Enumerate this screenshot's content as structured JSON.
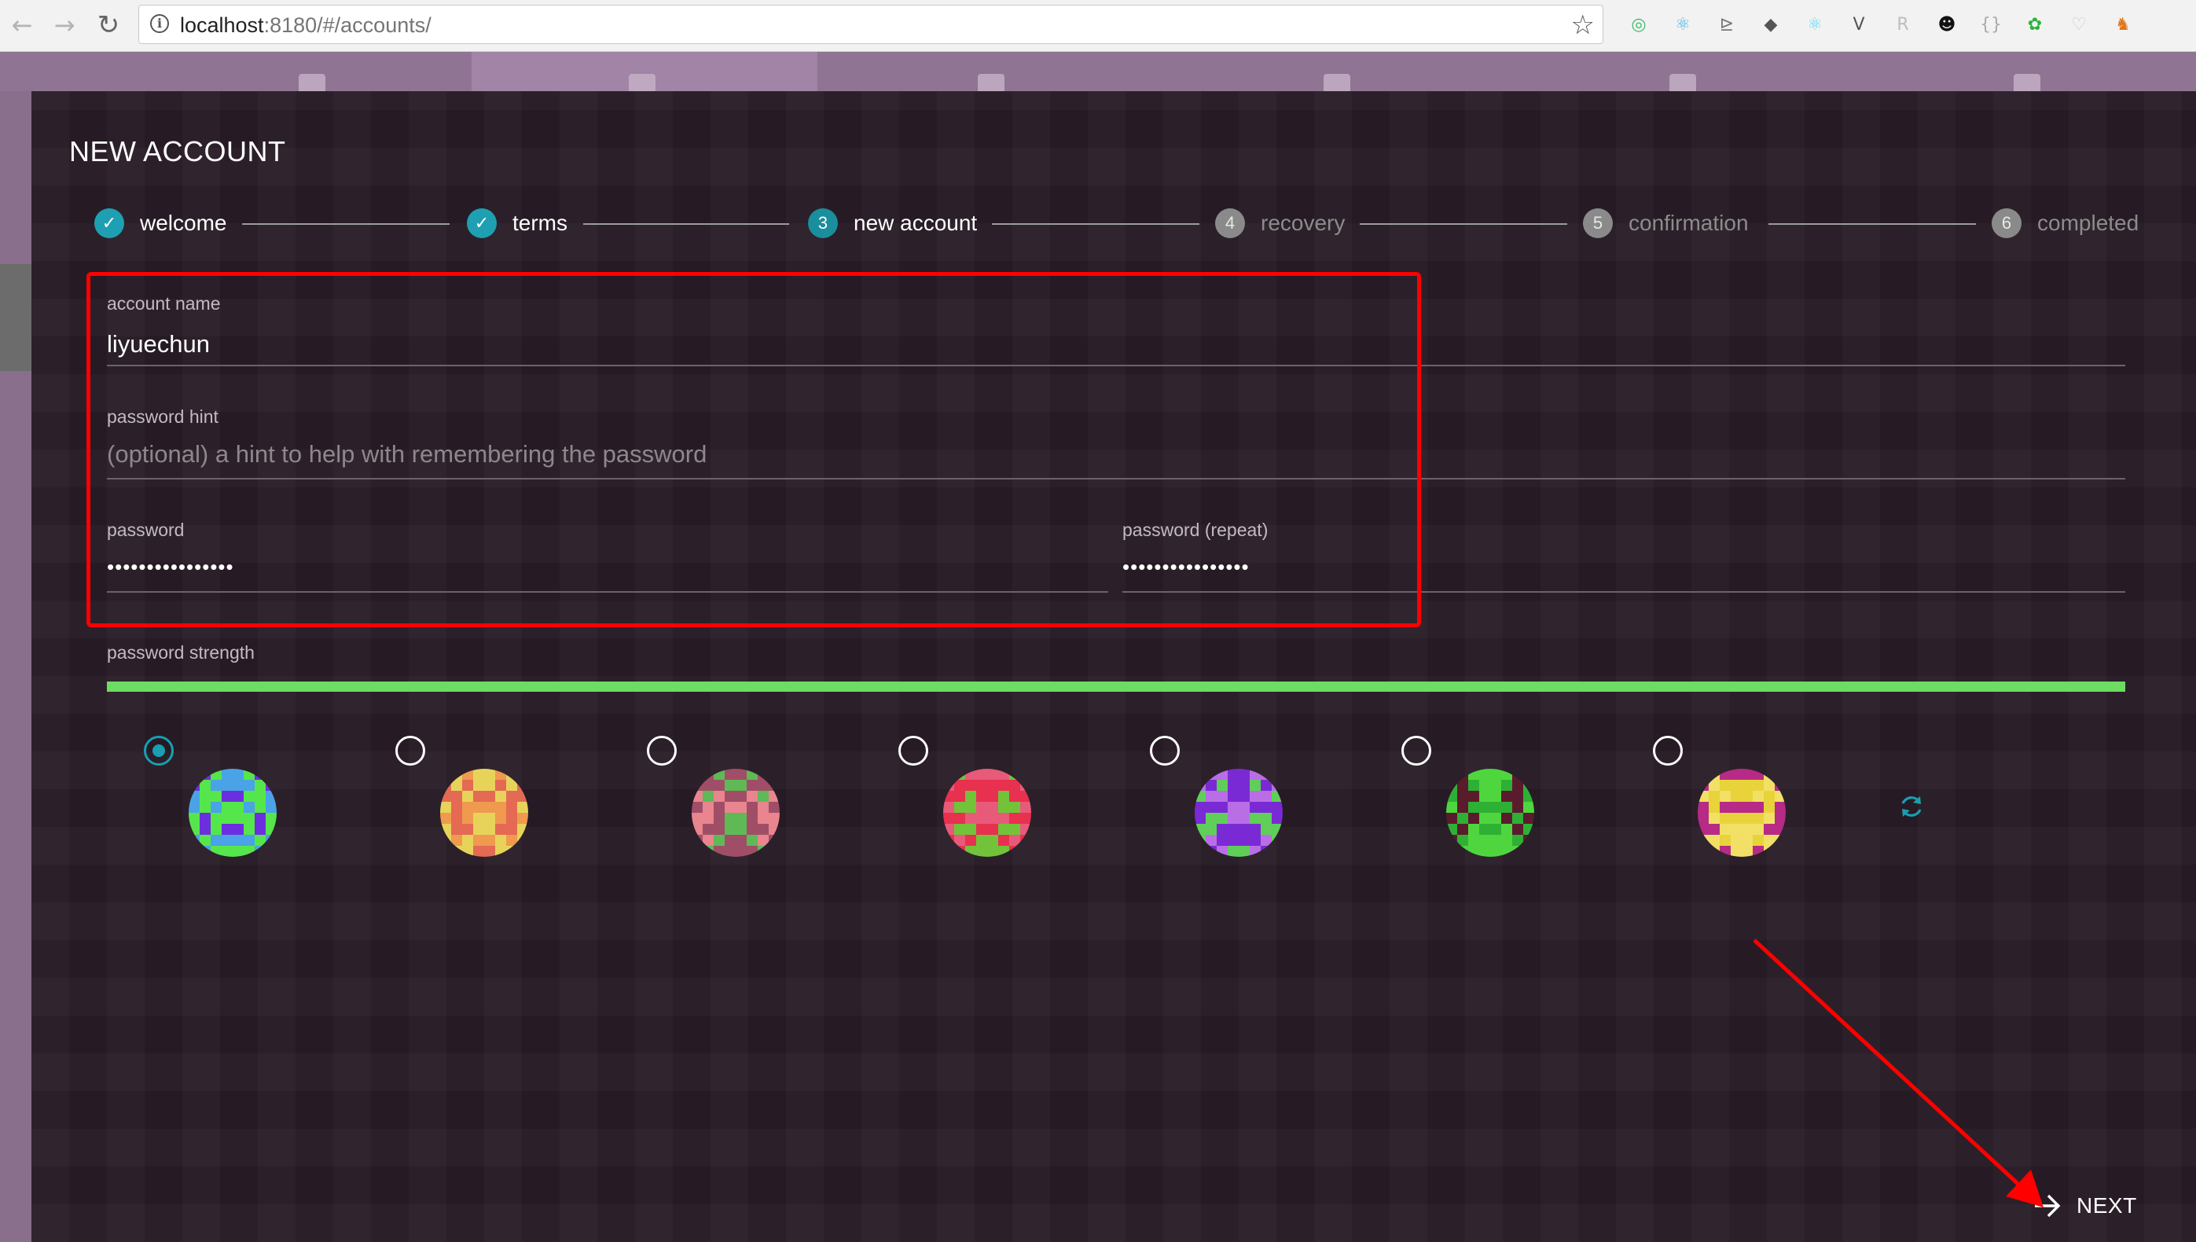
{
  "browser": {
    "url_host": "localhost",
    "url_rest": ":8180/#/accounts/",
    "back_icon": "back-arrow-icon",
    "forward_icon": "forward-arrow-icon",
    "reload_icon": "reload-icon",
    "info_glyph": "i",
    "star_icon": "bookmark-star-icon",
    "extensions": [
      {
        "name": "ext-green-circle-icon",
        "glyph": "◎",
        "color": "#3cbf6a"
      },
      {
        "name": "ext-react-icon",
        "glyph": "⚛",
        "color": "#49b6e6"
      },
      {
        "name": "ext-vue-fan-icon",
        "glyph": "⊵",
        "color": "#777777"
      },
      {
        "name": "ext-layers-icon",
        "glyph": "◆",
        "color": "#555555"
      },
      {
        "name": "ext-react-dark-icon",
        "glyph": "⚛",
        "color": "#61dafb"
      },
      {
        "name": "ext-vue-icon",
        "glyph": "V",
        "color": "#555555"
      },
      {
        "name": "ext-r-icon",
        "glyph": "R",
        "color": "#bdbdbd"
      },
      {
        "name": "ext-panda-icon",
        "glyph": "☻",
        "color": "#111111"
      },
      {
        "name": "ext-braces-icon",
        "glyph": "{}",
        "color": "#aaaaaa"
      },
      {
        "name": "ext-wechat-icon",
        "glyph": "✿",
        "color": "#2bb33a"
      },
      {
        "name": "ext-shield-icon",
        "glyph": "♡",
        "color": "#cccccc"
      },
      {
        "name": "ext-fox-icon",
        "glyph": "♞",
        "color": "#e2761b"
      }
    ]
  },
  "modal": {
    "title": "NEW ACCOUNT",
    "steps": [
      {
        "label": "welcome",
        "marker": "✓",
        "state": "done"
      },
      {
        "label": "terms",
        "marker": "✓",
        "state": "done"
      },
      {
        "label": "new account",
        "marker": "3",
        "state": "active"
      },
      {
        "label": "recovery",
        "marker": "4",
        "state": "pending"
      },
      {
        "label": "confirmation",
        "marker": "5",
        "state": "pending"
      },
      {
        "label": "completed",
        "marker": "6",
        "state": "pending"
      }
    ],
    "fields": {
      "account_name": {
        "label": "account name",
        "value": "liyuechun"
      },
      "password_hint": {
        "label": "password hint",
        "placeholder": "(optional) a hint to help with remembering the password"
      },
      "password": {
        "label": "password",
        "value": "••••••••••••••••"
      },
      "password_repeat": {
        "label": "password (repeat)",
        "value": "••••••••••••••••"
      }
    },
    "strength": {
      "label": "password strength",
      "level": 1.0,
      "color": "#6ddc63"
    },
    "identicons": {
      "selected_index": 0,
      "items": [
        {
          "name": "identicon-1",
          "colors": [
            "#55e64b",
            "#4aa3e6",
            "#6b2fe0"
          ]
        },
        {
          "name": "identicon-2",
          "colors": [
            "#ef9a4f",
            "#e8d35a",
            "#e46a53"
          ]
        },
        {
          "name": "identicon-3",
          "colors": [
            "#e9858e",
            "#5fb955",
            "#a04e67"
          ]
        },
        {
          "name": "identicon-4",
          "colors": [
            "#e8304f",
            "#72c33a",
            "#e85a7a"
          ]
        },
        {
          "name": "identicon-5",
          "colors": [
            "#7a2ad4",
            "#5fcf5a",
            "#b96ee6"
          ]
        },
        {
          "name": "identicon-6",
          "colors": [
            "#4fd63f",
            "#5a1c2c",
            "#2eb035"
          ]
        },
        {
          "name": "identicon-7",
          "colors": [
            "#e8d33a",
            "#b72a86",
            "#f2e066"
          ]
        }
      ],
      "refresh_icon": "refresh-icon"
    },
    "next_label": "NEXT",
    "next_icon": "arrow-right-icon"
  },
  "annotations": {
    "color": "#ff0000"
  }
}
